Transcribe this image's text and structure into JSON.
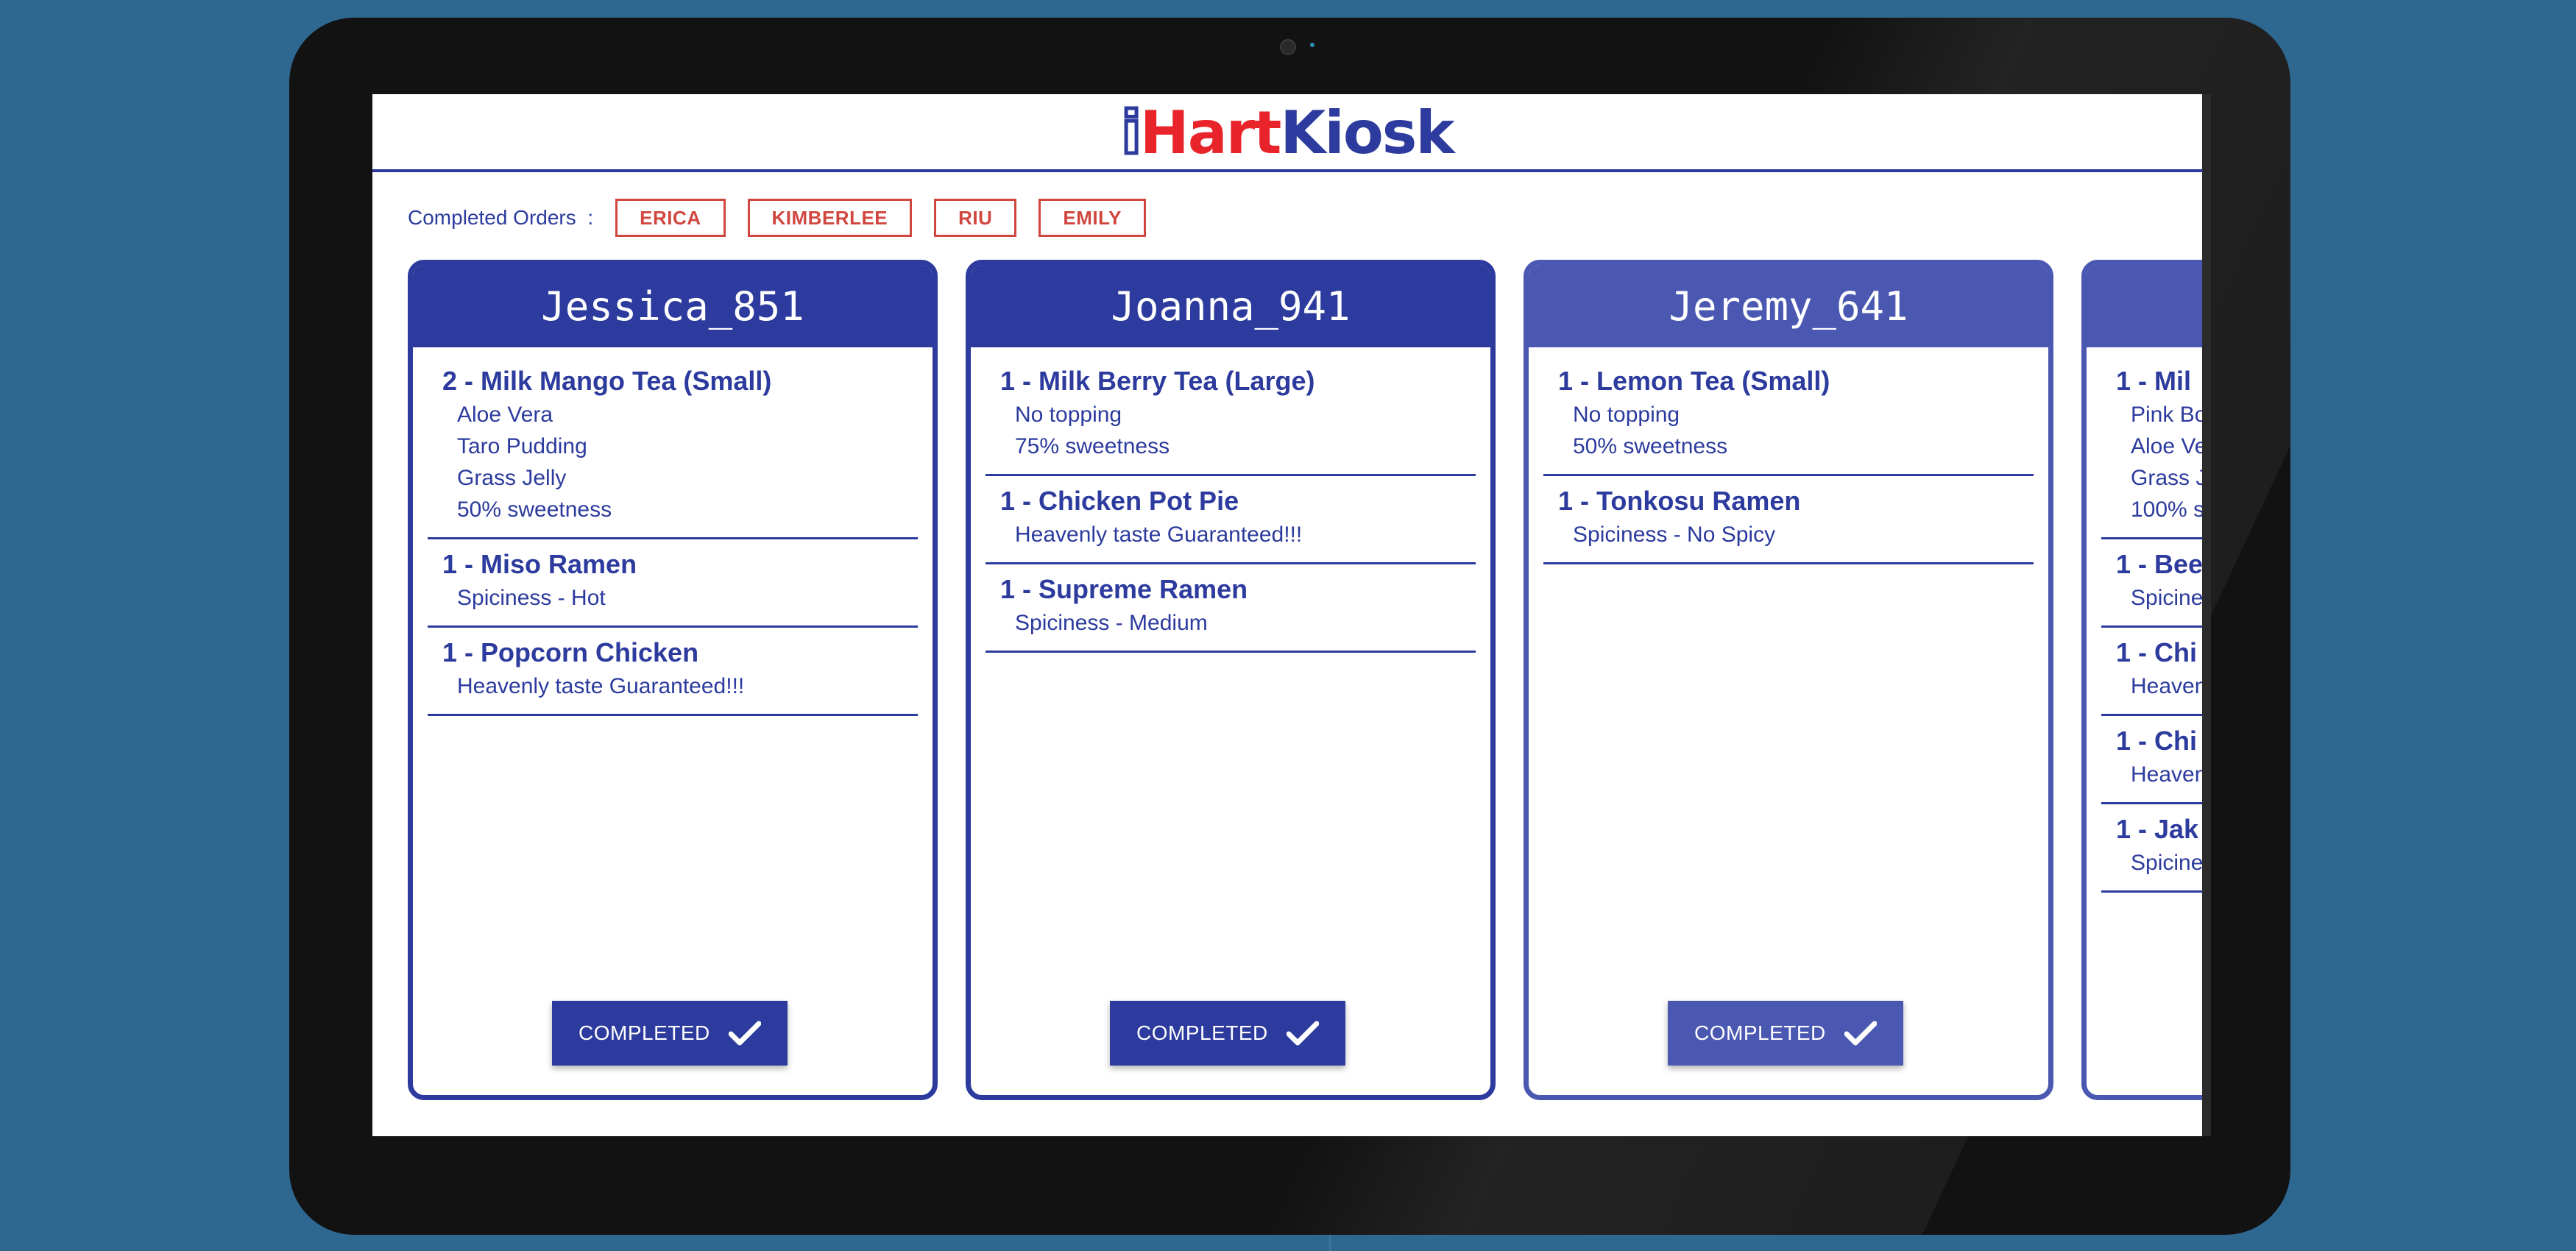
{
  "app": {
    "logo_i": "i",
    "logo_hart": "Hart",
    "logo_kiosk": "Kiosk"
  },
  "completed": {
    "label": "Completed Orders",
    "separator": ":",
    "names": [
      "ERICA",
      "KIMBERLEE",
      "RIU",
      "EMILY"
    ]
  },
  "button_label": "COMPLETED",
  "orders": [
    {
      "customer": "Jessica_851",
      "items": [
        {
          "title": "2 - Milk Mango Tea (Small)",
          "details": [
            "Aloe Vera",
            "Taro Pudding",
            "Grass Jelly",
            "50% sweetness"
          ]
        },
        {
          "title": "1 - Miso Ramen",
          "details": [
            "Spiciness - Hot"
          ]
        },
        {
          "title": "1 - Popcorn Chicken",
          "details": [
            "Heavenly taste Guaranteed!!!"
          ]
        }
      ]
    },
    {
      "customer": "Joanna_941",
      "items": [
        {
          "title": "1 - Milk Berry Tea (Large)",
          "details": [
            "No topping",
            "75% sweetness"
          ]
        },
        {
          "title": "1 - Chicken Pot Pie",
          "details": [
            "Heavenly taste Guaranteed!!!"
          ]
        },
        {
          "title": "1 - Supreme Ramen",
          "details": [
            "Spiciness - Medium"
          ]
        }
      ]
    },
    {
      "customer": "Jeremy_641",
      "items": [
        {
          "title": "1 - Lemon Tea (Small)",
          "details": [
            "No topping",
            "50% sweetness"
          ]
        },
        {
          "title": "1 - Tonkosu Ramen",
          "details": [
            "Spiciness - No Spicy"
          ]
        }
      ]
    },
    {
      "customer": "",
      "items": [
        {
          "title": "1 - Mil",
          "details": [
            "Pink Bo",
            "Aloe Ve",
            "Grass J",
            "100% s"
          ]
        },
        {
          "title": "1 - Bee",
          "details": [
            "Spicine"
          ]
        },
        {
          "title": "1 - Chi",
          "details": [
            "Heaven"
          ]
        },
        {
          "title": "1 - Chi",
          "details": [
            "Heaven"
          ]
        },
        {
          "title": "1 - Jak",
          "details": [
            "Spicine"
          ]
        }
      ]
    }
  ],
  "colors": {
    "primary": "#2c3b9d",
    "accent_red": "#d0473f",
    "logo_red": "#e8242a",
    "background": "#2e6891"
  }
}
